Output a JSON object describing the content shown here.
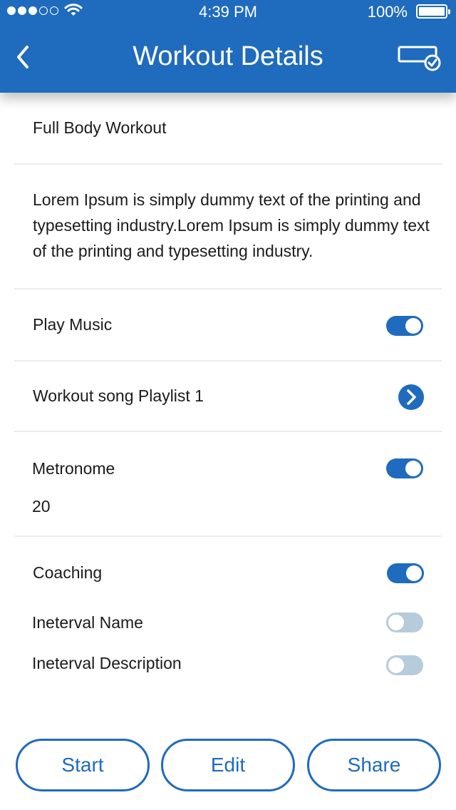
{
  "status_bar": {
    "time": "4:39 PM",
    "battery": "100%"
  },
  "header": {
    "title": "Workout Details"
  },
  "workout": {
    "name": "Full Body Workout",
    "description": "Lorem Ipsum is simply dummy text of the printing and typesetting industry.Lorem Ipsum is simply dummy text of the printing and typesetting industry."
  },
  "settings": {
    "play_music": {
      "label": "Play Music",
      "enabled": true
    },
    "playlist": {
      "label": "Workout song Playlist 1"
    },
    "metronome": {
      "label": "Metronome",
      "enabled": true,
      "value": "20"
    },
    "coaching": {
      "label": "Coaching",
      "enabled": true
    },
    "interval_name": {
      "label": "Ineterval Name",
      "enabled": false
    },
    "interval_description": {
      "label": "Ineterval Description",
      "enabled": false
    }
  },
  "buttons": {
    "start": "Start",
    "edit": "Edit",
    "share": "Share"
  },
  "colors": {
    "primary": "#1f6bbd",
    "toggle_off": "#b7ccda",
    "divider": "#ececec"
  },
  "icons": {
    "back": "chevron-left-icon",
    "action": "device-check-icon",
    "playlist": "chevron-right-circle-icon"
  }
}
